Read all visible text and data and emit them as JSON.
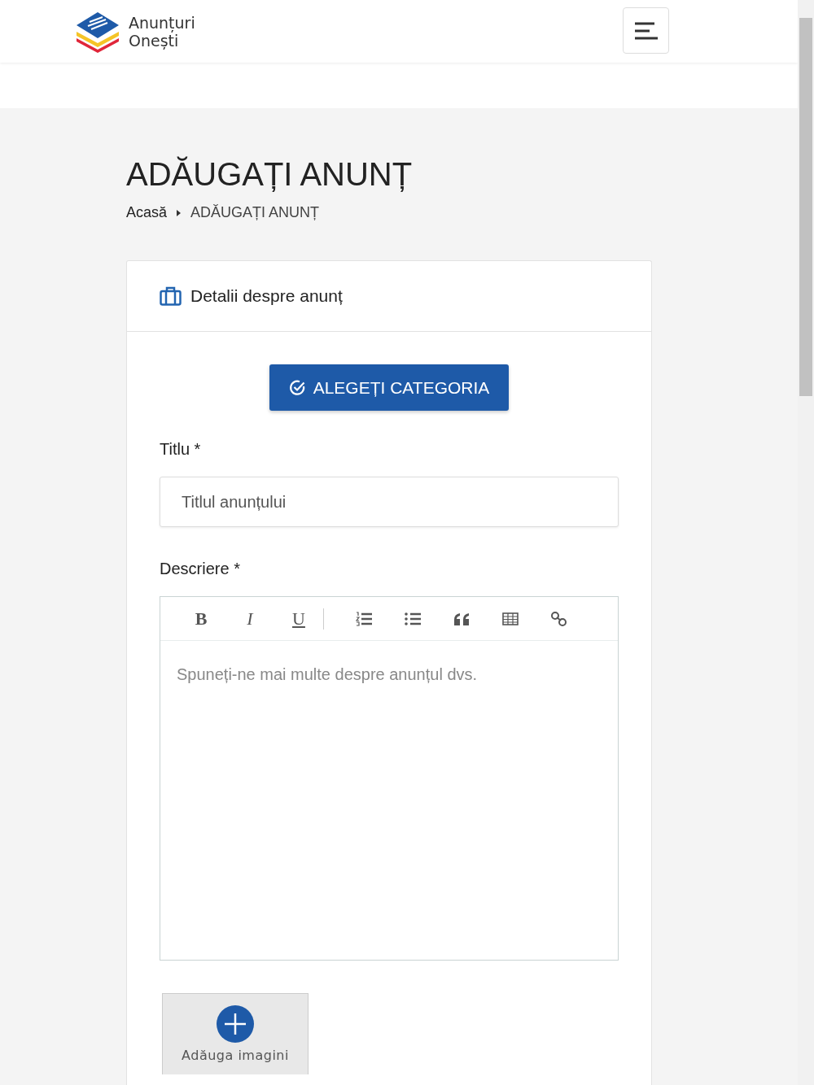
{
  "header": {
    "logo_line1": "Anunțuri",
    "logo_line2": "Onești"
  },
  "page": {
    "title": "ADĂUGAȚI ANUNȚ",
    "breadcrumb": [
      "Acasă",
      "ADĂUGAȚI ANUNȚ"
    ]
  },
  "card": {
    "title": "Detalii despre anunț",
    "category_button": "ALEGEȚI CATEGORIA",
    "fields": [
      {
        "label": "Titlu *",
        "placeholder": "Titlul anunțului"
      }
    ],
    "editor": {
      "label": "Descriere *",
      "placeholder": "Spuneți-ne mai multe despre anunțul dvs.",
      "toolbar": [
        {
          "kind": "bold",
          "label": "B"
        },
        {
          "kind": "italic",
          "label": "I"
        },
        {
          "kind": "underline",
          "label": "U"
        },
        {
          "kind": "separator"
        },
        {
          "kind": "ordered-list"
        },
        {
          "kind": "bullet-list"
        },
        {
          "kind": "quote"
        },
        {
          "kind": "table"
        },
        {
          "kind": "link"
        }
      ]
    },
    "image_button": "Adăuga imagini"
  }
}
